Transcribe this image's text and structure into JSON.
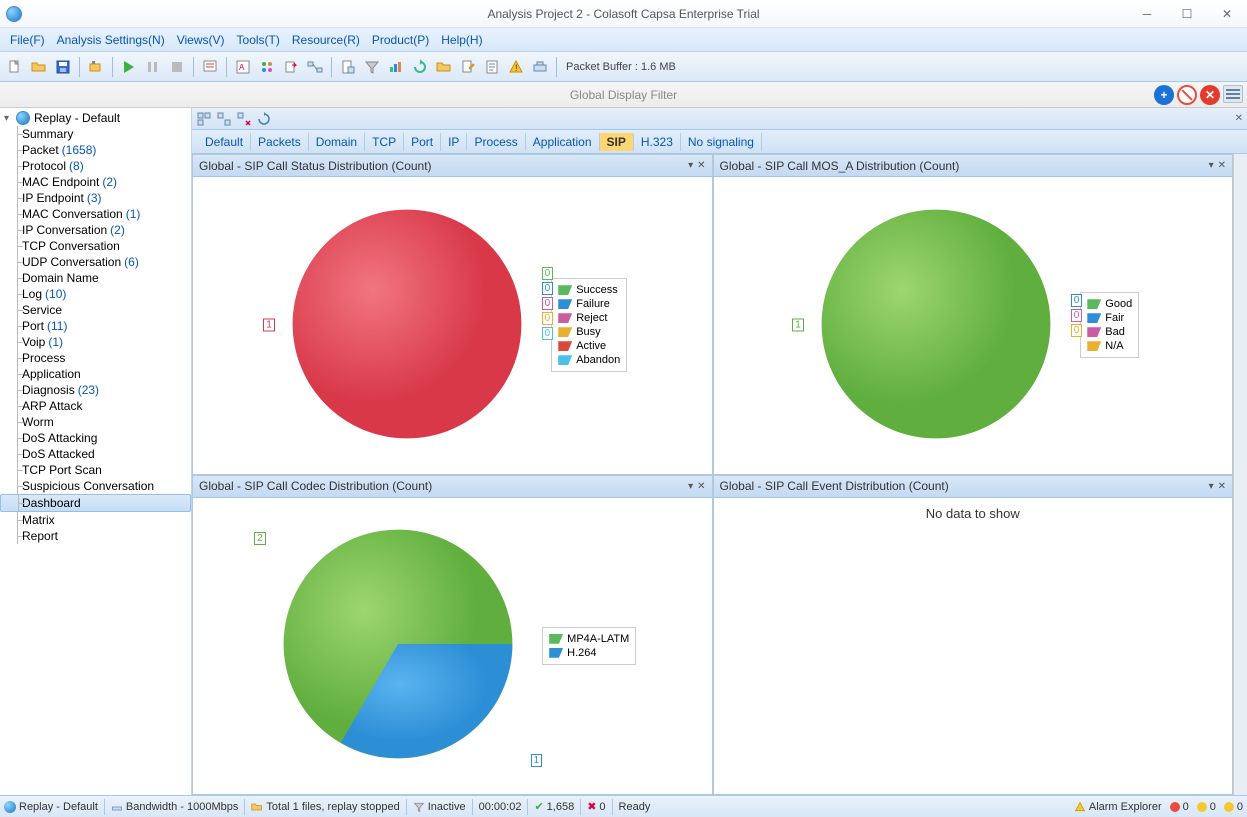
{
  "window": {
    "title": "Analysis Project 2 - Colasoft Capsa Enterprise Trial"
  },
  "menu": [
    "File(F)",
    "Analysis Settings(N)",
    "Views(V)",
    "Tools(T)",
    "Resource(R)",
    "Product(P)",
    "Help(H)"
  ],
  "toolbar": {
    "buffer_label": "Packet Buffer : 1.6 MB"
  },
  "filterbar": {
    "label": "Global Display Filter"
  },
  "sidebar": {
    "root": "Replay - Default",
    "items": [
      {
        "name": "Summary"
      },
      {
        "name": "Packet",
        "count": "(1658)"
      },
      {
        "name": "Protocol",
        "count": "(8)"
      },
      {
        "name": "MAC Endpoint",
        "count": "(2)"
      },
      {
        "name": "IP Endpoint",
        "count": "(3)"
      },
      {
        "name": "MAC Conversation",
        "count": "(1)"
      },
      {
        "name": "IP Conversation",
        "count": "(2)"
      },
      {
        "name": "TCP Conversation"
      },
      {
        "name": "UDP Conversation",
        "count": "(6)"
      },
      {
        "name": "Domain Name"
      },
      {
        "name": "Log",
        "count": "(10)"
      },
      {
        "name": "Service"
      },
      {
        "name": "Port",
        "count": "(11)"
      },
      {
        "name": "Voip",
        "count": "(1)"
      },
      {
        "name": "Process"
      },
      {
        "name": "Application"
      },
      {
        "name": "Diagnosis",
        "count": "(23)"
      },
      {
        "name": "ARP Attack"
      },
      {
        "name": "Worm"
      },
      {
        "name": "DoS Attacking"
      },
      {
        "name": "DoS Attacked"
      },
      {
        "name": "TCP Port Scan"
      },
      {
        "name": "Suspicious Conversation"
      },
      {
        "name": "Dashboard",
        "selected": true
      },
      {
        "name": "Matrix"
      },
      {
        "name": "Report"
      }
    ]
  },
  "tabs": [
    "Default",
    "Packets",
    "Domain",
    "TCP",
    "Port",
    "IP",
    "Process",
    "Application",
    "SIP",
    "H.323",
    "No signaling"
  ],
  "active_tab": "SIP",
  "panels": {
    "tl": {
      "title": "Global - SIP Call Status Distribution (Count)",
      "legend": [
        "Success",
        "Failure",
        "Reject",
        "Busy",
        "Active",
        "Abandon"
      ],
      "legend_colors": [
        "#5cb85c",
        "#2e8fd8",
        "#c95ca3",
        "#e8b030",
        "#d84a3a",
        "#48c0e8"
      ],
      "main_label": "1",
      "zero_labels": [
        "0",
        "0",
        "0",
        "0",
        "0"
      ]
    },
    "tr": {
      "title": "Global - SIP Call MOS_A Distribution (Count)",
      "legend": [
        "Good",
        "Fair",
        "Bad",
        "N/A"
      ],
      "legend_colors": [
        "#5cb85c",
        "#2e8fd8",
        "#c95ca3",
        "#e8b030"
      ],
      "main_label": "1",
      "zero_labels": [
        "0",
        "0",
        "0"
      ]
    },
    "bl": {
      "title": "Global - SIP Call Codec Distribution (Count)",
      "legend": [
        "MP4A-LATM",
        "H.264"
      ],
      "legend_colors": [
        "#5cb85c",
        "#2e8fd8"
      ],
      "labels": [
        "2",
        "1"
      ]
    },
    "br": {
      "title": "Global - SIP Call Event Distribution (Count)",
      "nodata": "No data to show"
    }
  },
  "chart_data": [
    {
      "type": "pie",
      "title": "Global - SIP Call Status Distribution (Count)",
      "categories": [
        "Success",
        "Failure",
        "Reject",
        "Busy",
        "Active",
        "Abandon"
      ],
      "values": [
        0,
        0,
        0,
        0,
        1,
        0
      ]
    },
    {
      "type": "pie",
      "title": "Global - SIP Call MOS_A Distribution (Count)",
      "categories": [
        "Good",
        "Fair",
        "Bad",
        "N/A"
      ],
      "values": [
        1,
        0,
        0,
        0
      ]
    },
    {
      "type": "pie",
      "title": "Global - SIP Call Codec Distribution (Count)",
      "categories": [
        "MP4A-LATM",
        "H.264"
      ],
      "values": [
        2,
        1
      ]
    },
    {
      "type": "pie",
      "title": "Global - SIP Call Event Distribution (Count)",
      "categories": [],
      "values": []
    }
  ],
  "statusbar": {
    "replay": "Replay - Default",
    "bandwidth": "Bandwidth - 1000Mbps",
    "files": "Total 1 files, replay stopped",
    "filter": "Inactive",
    "time": "00:00:02",
    "packets": "1,658",
    "errors": "0",
    "ready": "Ready",
    "alarm": "Alarm Explorer",
    "a_red": "0",
    "a_yellow": "0",
    "a_green": "0"
  }
}
